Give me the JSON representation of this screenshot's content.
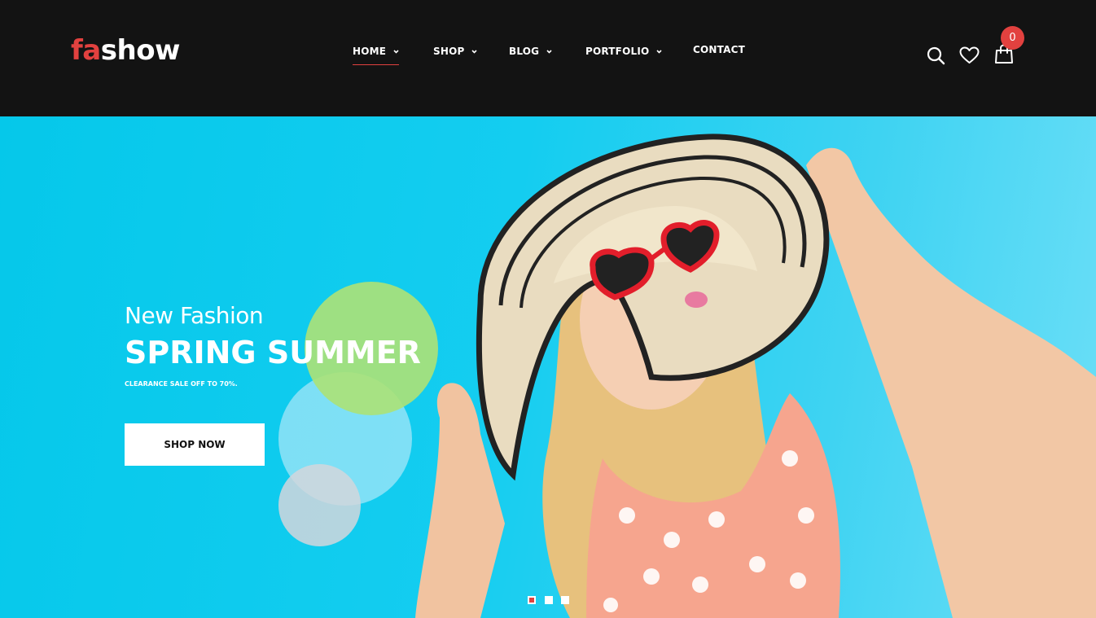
{
  "brand": {
    "logo_prefix": "fa",
    "logo_suffix": "show",
    "accent_color": "#e2413f"
  },
  "nav": {
    "items": [
      {
        "label": "HOME",
        "has_dropdown": true,
        "active": true
      },
      {
        "label": "SHOP",
        "has_dropdown": true,
        "active": false
      },
      {
        "label": "BLOG",
        "has_dropdown": true,
        "active": false
      },
      {
        "label": "PORTFOLIO",
        "has_dropdown": true,
        "active": false
      },
      {
        "label": "CONTACT",
        "has_dropdown": false,
        "active": false
      }
    ]
  },
  "header_icons": {
    "search": "search-icon",
    "wishlist": "heart-icon",
    "cart": "shopping-bag-icon",
    "cart_count": "0"
  },
  "hero": {
    "eyebrow": "New Fashion",
    "headline": "SPRING SUMMER",
    "subline": "CLEARANCE SALE OFF TO 70%.",
    "cta_label": "SHOP NOW",
    "background_color": "#14cdf0",
    "slides": {
      "count": 3,
      "active_index": 0
    }
  }
}
